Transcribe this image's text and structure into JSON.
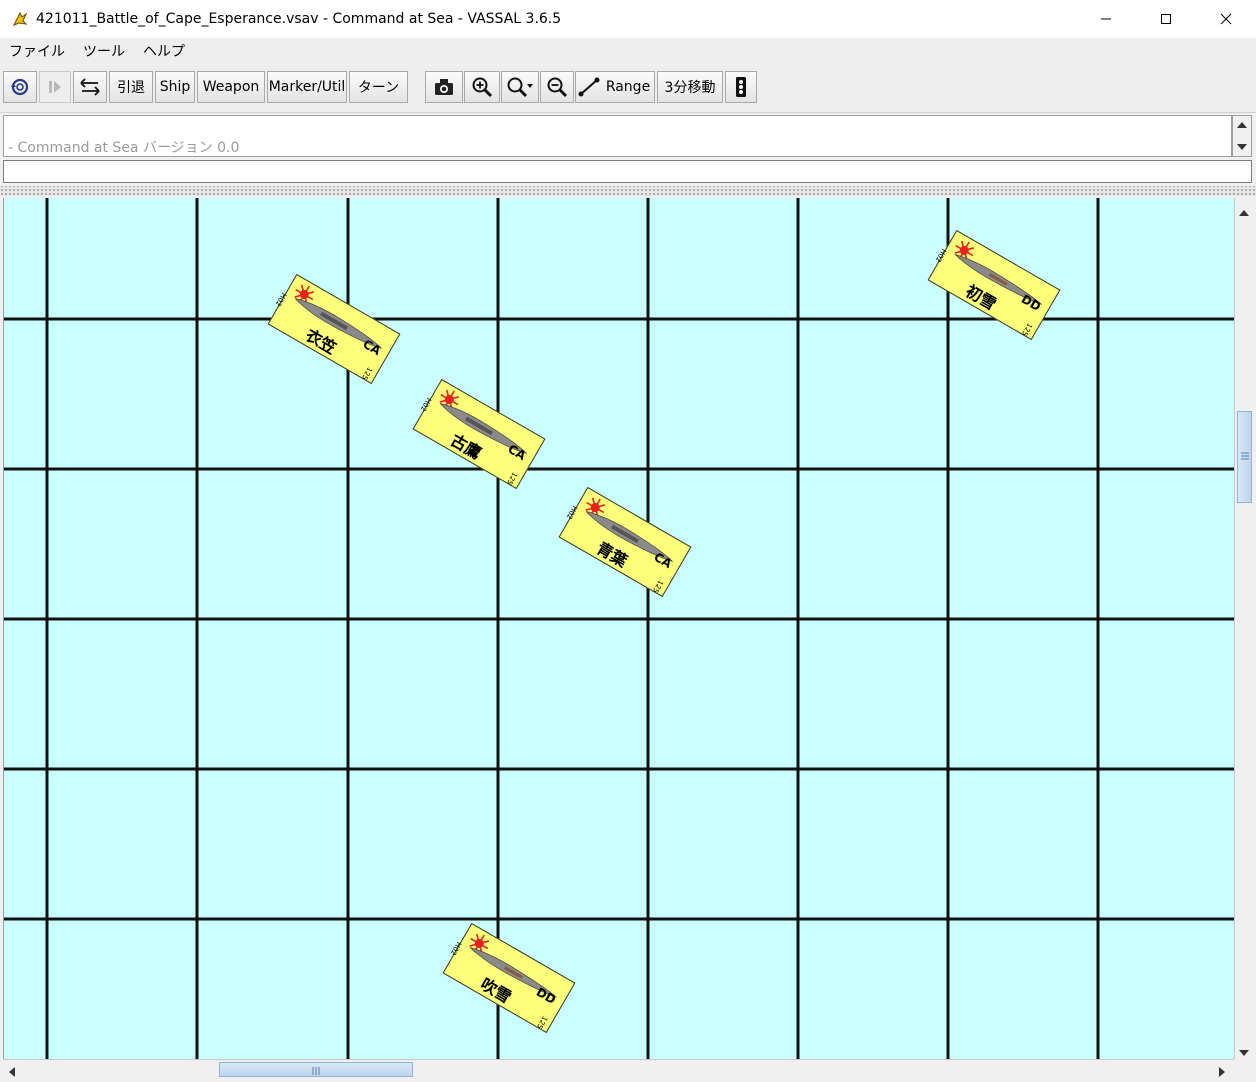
{
  "window": {
    "title": "421011_Battle_of_Cape_Esperance.vsav - Command at Sea - VASSAL 3.6.5",
    "controls": [
      "minimize",
      "maximize",
      "close"
    ]
  },
  "menu": [
    "ファイル",
    "ツール",
    "ヘルプ"
  ],
  "toolbar": {
    "buttons": [
      {
        "id": "undo",
        "icon": "undo-icon"
      },
      {
        "id": "step",
        "icon": "step-forward-icon"
      },
      {
        "id": "sync",
        "icon": "swap-arrows-icon"
      },
      {
        "id": "retreat",
        "label": "引退"
      },
      {
        "id": "ship",
        "label": "Ship"
      },
      {
        "id": "weapon",
        "label": "Weapon"
      },
      {
        "id": "marker",
        "label": "Marker/Util"
      },
      {
        "id": "turn",
        "label": "ターン"
      },
      {
        "id": "screenshot",
        "icon": "camera-icon"
      },
      {
        "id": "zoom-in",
        "icon": "zoom-in-icon"
      },
      {
        "id": "zoom-select",
        "icon": "zoom-select-icon"
      },
      {
        "id": "zoom-out",
        "icon": "zoom-out-icon"
      },
      {
        "id": "range",
        "label": "Range",
        "icon": "ruler-line-icon"
      },
      {
        "id": "move3",
        "label": "3分移動"
      },
      {
        "id": "counter",
        "icon": "traffic-light-icon"
      }
    ]
  },
  "chat": {
    "log": [
      "- Command at Sea バージョン 0.0"
    ],
    "input_value": ""
  },
  "map": {
    "background": "#c9ffff",
    "grid_color": "#111111",
    "pieces": [
      {
        "name": "衣笠",
        "class": "CA",
        "left_code": "H02",
        "right_code": "125"
      },
      {
        "name": "古鷹",
        "class": "CA",
        "left_code": "H02",
        "right_code": "125"
      },
      {
        "name": "青葉",
        "class": "CA",
        "left_code": "H02",
        "right_code": "125"
      },
      {
        "name": "初雪",
        "class": "DD",
        "left_code": "H02",
        "right_code": "125"
      },
      {
        "name": "吹雪",
        "class": "DD",
        "left_code": "H02",
        "right_code": "125"
      }
    ]
  },
  "colors": {
    "counter_yellow": "#fbff7a",
    "flag_red": "#e8211d",
    "scroll_thumb": "#c6dcf0"
  }
}
